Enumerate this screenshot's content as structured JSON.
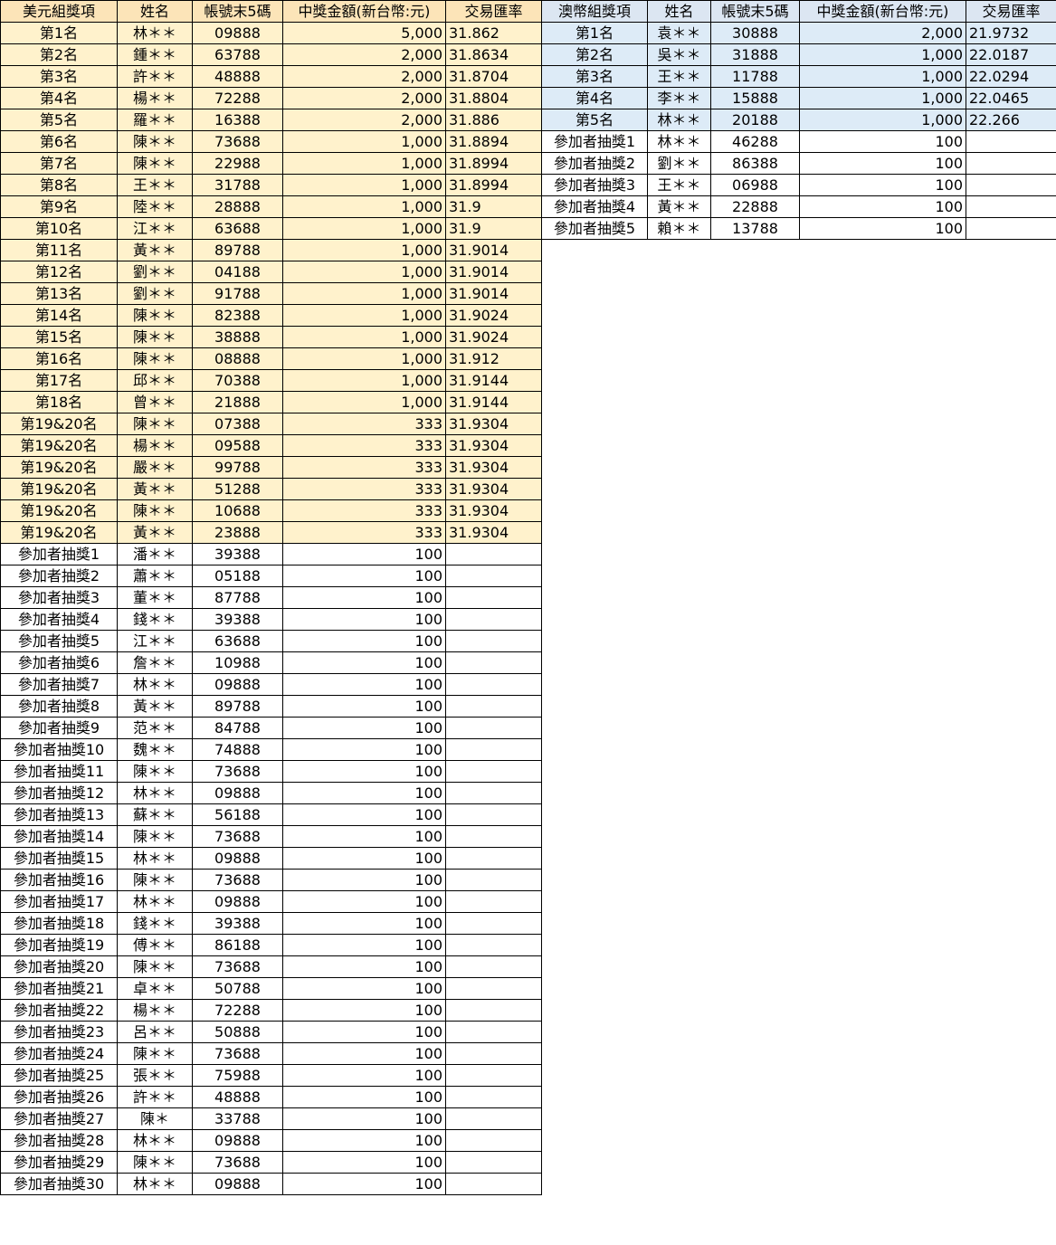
{
  "usd_table": {
    "headers": [
      "美元組獎項",
      "姓名",
      "帳號末5碼",
      "中獎金額(新台幣:元)",
      "交易匯率"
    ],
    "rows": [
      [
        "第1名",
        "林＊＊",
        "09888",
        "5,000",
        "31.862"
      ],
      [
        "第2名",
        "鍾＊＊",
        "63788",
        "2,000",
        "31.8634"
      ],
      [
        "第3名",
        "許＊＊",
        "48888",
        "2,000",
        "31.8704"
      ],
      [
        "第4名",
        "楊＊＊",
        "72288",
        "2,000",
        "31.8804"
      ],
      [
        "第5名",
        "羅＊＊",
        "16388",
        "2,000",
        "31.886"
      ],
      [
        "第6名",
        "陳＊＊",
        "73688",
        "1,000",
        "31.8894"
      ],
      [
        "第7名",
        "陳＊＊",
        "22988",
        "1,000",
        "31.8994"
      ],
      [
        "第8名",
        "王＊＊",
        "31788",
        "1,000",
        "31.8994"
      ],
      [
        "第9名",
        "陸＊＊",
        "28888",
        "1,000",
        "31.9"
      ],
      [
        "第10名",
        "江＊＊",
        "63688",
        "1,000",
        "31.9"
      ],
      [
        "第11名",
        "黃＊＊",
        "89788",
        "1,000",
        "31.9014"
      ],
      [
        "第12名",
        "劉＊＊",
        "04188",
        "1,000",
        "31.9014"
      ],
      [
        "第13名",
        "劉＊＊",
        "91788",
        "1,000",
        "31.9014"
      ],
      [
        "第14名",
        "陳＊＊",
        "82388",
        "1,000",
        "31.9024"
      ],
      [
        "第15名",
        "陳＊＊",
        "38888",
        "1,000",
        "31.9024"
      ],
      [
        "第16名",
        "陳＊＊",
        "08888",
        "1,000",
        "31.912"
      ],
      [
        "第17名",
        "邱＊＊",
        "70388",
        "1,000",
        "31.9144"
      ],
      [
        "第18名",
        "曾＊＊",
        "21888",
        "1,000",
        "31.9144"
      ],
      [
        "第19&20名",
        "陳＊＊",
        "07388",
        "333",
        "31.9304"
      ],
      [
        "第19&20名",
        "楊＊＊",
        "09588",
        "333",
        "31.9304"
      ],
      [
        "第19&20名",
        "嚴＊＊",
        "99788",
        "333",
        "31.9304"
      ],
      [
        "第19&20名",
        "黃＊＊",
        "51288",
        "333",
        "31.9304"
      ],
      [
        "第19&20名",
        "陳＊＊",
        "10688",
        "333",
        "31.9304"
      ],
      [
        "第19&20名",
        "黃＊＊",
        "23888",
        "333",
        "31.9304"
      ],
      [
        "參加者抽獎1",
        "潘＊＊",
        "39388",
        "100",
        ""
      ],
      [
        "參加者抽獎2",
        "蕭＊＊",
        "05188",
        "100",
        ""
      ],
      [
        "參加者抽獎3",
        "董＊＊",
        "87788",
        "100",
        ""
      ],
      [
        "參加者抽獎4",
        "錢＊＊",
        "39388",
        "100",
        ""
      ],
      [
        "參加者抽獎5",
        "江＊＊",
        "63688",
        "100",
        ""
      ],
      [
        "參加者抽獎6",
        "詹＊＊",
        "10988",
        "100",
        ""
      ],
      [
        "參加者抽獎7",
        "林＊＊",
        "09888",
        "100",
        ""
      ],
      [
        "參加者抽獎8",
        "黃＊＊",
        "89788",
        "100",
        ""
      ],
      [
        "參加者抽獎9",
        "范＊＊",
        "84788",
        "100",
        ""
      ],
      [
        "參加者抽獎10",
        "魏＊＊",
        "74888",
        "100",
        ""
      ],
      [
        "參加者抽獎11",
        "陳＊＊",
        "73688",
        "100",
        ""
      ],
      [
        "參加者抽獎12",
        "林＊＊",
        "09888",
        "100",
        ""
      ],
      [
        "參加者抽獎13",
        "蘇＊＊",
        "56188",
        "100",
        ""
      ],
      [
        "參加者抽獎14",
        "陳＊＊",
        "73688",
        "100",
        ""
      ],
      [
        "參加者抽獎15",
        "林＊＊",
        "09888",
        "100",
        ""
      ],
      [
        "參加者抽獎16",
        "陳＊＊",
        "73688",
        "100",
        ""
      ],
      [
        "參加者抽獎17",
        "林＊＊",
        "09888",
        "100",
        ""
      ],
      [
        "參加者抽獎18",
        "錢＊＊",
        "39388",
        "100",
        ""
      ],
      [
        "參加者抽獎19",
        "傅＊＊",
        "86188",
        "100",
        ""
      ],
      [
        "參加者抽獎20",
        "陳＊＊",
        "73688",
        "100",
        ""
      ],
      [
        "參加者抽獎21",
        "卓＊＊",
        "50788",
        "100",
        ""
      ],
      [
        "參加者抽獎22",
        "楊＊＊",
        "72288",
        "100",
        ""
      ],
      [
        "參加者抽獎23",
        "呂＊＊",
        "50888",
        "100",
        ""
      ],
      [
        "參加者抽獎24",
        "陳＊＊",
        "73688",
        "100",
        ""
      ],
      [
        "參加者抽獎25",
        "張＊＊",
        "75988",
        "100",
        ""
      ],
      [
        "參加者抽獎26",
        "許＊＊",
        "48888",
        "100",
        ""
      ],
      [
        "參加者抽獎27",
        "陳＊",
        "33788",
        "100",
        ""
      ],
      [
        "參加者抽獎28",
        "林＊＊",
        "09888",
        "100",
        ""
      ],
      [
        "參加者抽獎29",
        "陳＊＊",
        "73688",
        "100",
        ""
      ],
      [
        "參加者抽獎30",
        "林＊＊",
        "09888",
        "100",
        ""
      ]
    ],
    "ranked_count": 24
  },
  "aud_table": {
    "headers": [
      "澳幣組獎項",
      "姓名",
      "帳號末5碼",
      "中獎金額(新台幣:元)",
      "交易匯率"
    ],
    "rows": [
      [
        "第1名",
        "袁＊＊",
        "30888",
        "2,000",
        "21.9732"
      ],
      [
        "第2名",
        "吳＊＊",
        "31888",
        "1,000",
        "22.0187"
      ],
      [
        "第3名",
        "王＊＊",
        "11788",
        "1,000",
        "22.0294"
      ],
      [
        "第4名",
        "李＊＊",
        "15888",
        "1,000",
        "22.0465"
      ],
      [
        "第5名",
        "林＊＊",
        "20188",
        "1,000",
        "22.266"
      ],
      [
        "參加者抽獎1",
        "林＊＊",
        "46288",
        "100",
        ""
      ],
      [
        "參加者抽獎2",
        "劉＊＊",
        "86388",
        "100",
        ""
      ],
      [
        "參加者抽獎3",
        "王＊＊",
        "06988",
        "100",
        ""
      ],
      [
        "參加者抽獎4",
        "黃＊＊",
        "22888",
        "100",
        ""
      ],
      [
        "參加者抽獎5",
        "賴＊＊",
        "13788",
        "100",
        ""
      ]
    ],
    "ranked_count": 5
  },
  "colors": {
    "usd_header": "#FCE4B8",
    "usd_ranked_row": "#FFF2CC",
    "aud_header": "#DCE6F2",
    "aud_ranked_row": "#DDEBF7"
  }
}
